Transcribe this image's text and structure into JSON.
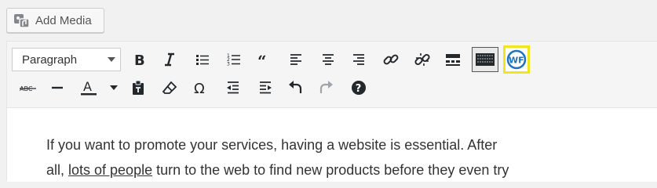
{
  "media": {
    "add_media_label": "Add Media"
  },
  "toolbar": {
    "format_value": "Paragraph",
    "wf_label": "WF",
    "buttons_row1": [
      "bold",
      "italic",
      "bulleted-list",
      "numbered-list",
      "blockquote",
      "align-left",
      "align-center",
      "align-right",
      "insert-link",
      "remove-link",
      "read-more",
      "toolbar-toggle",
      "wf-plugin"
    ],
    "buttons_row2": [
      "strikethrough",
      "horizontal-line",
      "text-color",
      "paste-as-text",
      "clear-formatting",
      "special-character",
      "decrease-indent",
      "increase-indent",
      "undo",
      "redo",
      "keyboard-shortcuts"
    ],
    "wf_highlight_color": "#f0e61e",
    "accent": "#23282d"
  },
  "content": {
    "line1": "If you want to promote your services, having a website is essential. After",
    "line2_pre": "all, ",
    "line2_link": "lots of people",
    "line2_post": " turn to the web to find new products before they even try"
  }
}
